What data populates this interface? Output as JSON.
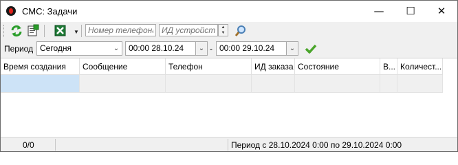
{
  "window": {
    "title": "СМС: Задачи",
    "minimize_glyph": "—",
    "maximize_glyph": "☐",
    "close_glyph": "✕"
  },
  "toolbar": {
    "refresh_icon": "refresh-icon",
    "properties_icon": "properties-icon",
    "excel_icon": "excel-export-icon",
    "phone_placeholder": "Номер телефона",
    "device_placeholder": "ИД устройства",
    "search_icon": "magnifier-icon",
    "accent": "#2a9d2a"
  },
  "filter": {
    "period_label": "Период",
    "period_value": "Сегодня",
    "from_value": "00:00 28.10.24",
    "dash": "-",
    "to_value": "00:00 29.10.24",
    "apply_icon": "checkmark-icon"
  },
  "grid": {
    "columns": [
      "Время создания",
      "Сообщение",
      "Телефон",
      "ИД заказа",
      "Состояние",
      "В...",
      "Количест..."
    ],
    "selection_color": "#cde3f7"
  },
  "status": {
    "count": "0/0",
    "period_text": "Период с 28.10.2024 0:00 по 29.10.2024 0:00"
  }
}
